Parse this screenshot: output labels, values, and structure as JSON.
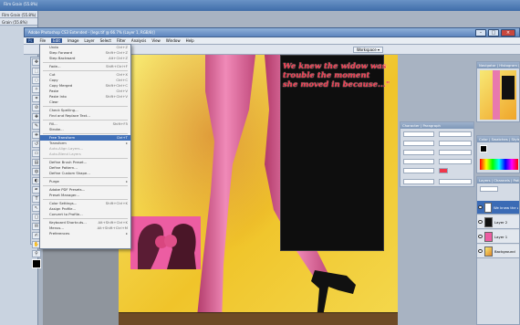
{
  "back_window": {
    "title": "Film Grain (55.8%)",
    "side_title": "Film Grain (55.8%)",
    "side_sub": "Grain (55.8%)"
  },
  "window": {
    "title": "Adobe Photoshop CS3 Extended - [legs.tif @ 66.7% (Layer 1, RGB/8)]"
  },
  "menubar": [
    "Ps",
    "File",
    "Edit",
    "Image",
    "Layer",
    "Select",
    "Filter",
    "Analysis",
    "View",
    "Window",
    "Help"
  ],
  "options_bar": {
    "workspace": "Workspace ▾"
  },
  "edit_menu": {
    "items": [
      {
        "label": "Undo",
        "shortcut": "Ctrl+Z"
      },
      {
        "label": "Step Forward",
        "shortcut": "Shift+Ctrl+Z"
      },
      {
        "label": "Step Backward",
        "shortcut": "Alt+Ctrl+Z"
      },
      {
        "sep": true
      },
      {
        "label": "Fade...",
        "shortcut": "Shift+Ctrl+F"
      },
      {
        "sep": true
      },
      {
        "label": "Cut",
        "shortcut": "Ctrl+X"
      },
      {
        "label": "Copy",
        "shortcut": "Ctrl+C"
      },
      {
        "label": "Copy Merged",
        "shortcut": "Shift+Ctrl+C"
      },
      {
        "label": "Paste",
        "shortcut": "Ctrl+V"
      },
      {
        "label": "Paste Into",
        "shortcut": "Shift+Ctrl+V"
      },
      {
        "label": "Clear",
        "shortcut": ""
      },
      {
        "sep": true
      },
      {
        "label": "Check Spelling...",
        "shortcut": ""
      },
      {
        "label": "Find and Replace Text...",
        "shortcut": ""
      },
      {
        "sep": true
      },
      {
        "label": "Fill...",
        "shortcut": "Shift+F5"
      },
      {
        "label": "Stroke...",
        "shortcut": ""
      },
      {
        "sep": true
      },
      {
        "label": "Free Transform",
        "shortcut": "Ctrl+T",
        "highlighted": true
      },
      {
        "label": "Transform",
        "shortcut": "▸"
      },
      {
        "label": "Auto-Align Layers...",
        "shortcut": "",
        "disabled": true
      },
      {
        "label": "Auto-Blend Layers",
        "shortcut": "",
        "disabled": true
      },
      {
        "sep": true
      },
      {
        "label": "Define Brush Preset...",
        "shortcut": ""
      },
      {
        "label": "Define Pattern...",
        "shortcut": ""
      },
      {
        "label": "Define Custom Shape...",
        "shortcut": ""
      },
      {
        "sep": true
      },
      {
        "label": "Purge",
        "shortcut": "▸"
      },
      {
        "sep": true
      },
      {
        "label": "Adobe PDF Presets...",
        "shortcut": ""
      },
      {
        "label": "Preset Manager...",
        "shortcut": ""
      },
      {
        "sep": true
      },
      {
        "label": "Color Settings...",
        "shortcut": "Shift+Ctrl+K"
      },
      {
        "label": "Assign Profile...",
        "shortcut": ""
      },
      {
        "label": "Convert to Profile...",
        "shortcut": ""
      },
      {
        "sep": true
      },
      {
        "label": "Keyboard Shortcuts...",
        "shortcut": "Alt+Shift+Ctrl+K"
      },
      {
        "label": "Menus...",
        "shortcut": "Alt+Shift+Ctrl+M"
      },
      {
        "label": "Preferences",
        "shortcut": "▸"
      }
    ]
  },
  "canvas": {
    "quote_lines": [
      "We knew the widow was",
      "trouble the moment",
      "she moved in because...\""
    ]
  },
  "panels": {
    "navigator": "Navigator | Histogram | Info",
    "character": "Character | Paragraph",
    "color": "Color | Swatches | Styles",
    "layers": {
      "tabs": "Layers | Channels | Paths",
      "items": [
        "We knew the wi",
        "Layer 2",
        "Layer 1",
        "Background"
      ]
    }
  },
  "colors": {
    "accent": "#3f6fb8",
    "quote": "#f0364a",
    "canvas_bg": "#f0c42a"
  }
}
